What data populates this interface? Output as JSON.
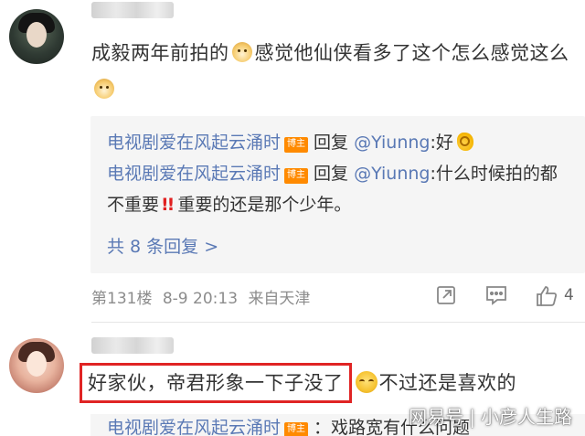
{
  "comments": [
    {
      "text_part1": "成毅两年前拍的",
      "text_part2": "感觉他仙侠看多了这个怎么感觉这么",
      "replies": [
        {
          "author": "电视剧爱在风起云涌时",
          "badge": "博主",
          "prefix": "回复",
          "mention": "@Yiunng",
          "text": ":好"
        },
        {
          "author": "电视剧爱在风起云涌时",
          "badge": "博主",
          "prefix": "回复",
          "mention": "@Yiunng",
          "text_part1": ":什么时候拍的都不重要",
          "exclaim": "!!",
          "text_part2": "重要的还是那个少年。"
        }
      ],
      "more_replies": "共 8 条回复 >",
      "meta": {
        "floor": "第131楼",
        "date": "8-9 20:13",
        "source": "来自天津"
      },
      "like_count": "4"
    },
    {
      "highlight_text": "好家伙，帝君形象一下子没了",
      "text_after": "不过还是喜欢的",
      "reply_peek": {
        "author": "电视剧爱在风起云涌时",
        "badge": "博主",
        "text": "：戏路宽有什么问题"
      }
    }
  ],
  "watermark": {
    "site": "网易号",
    "author": "小彦人生路"
  }
}
